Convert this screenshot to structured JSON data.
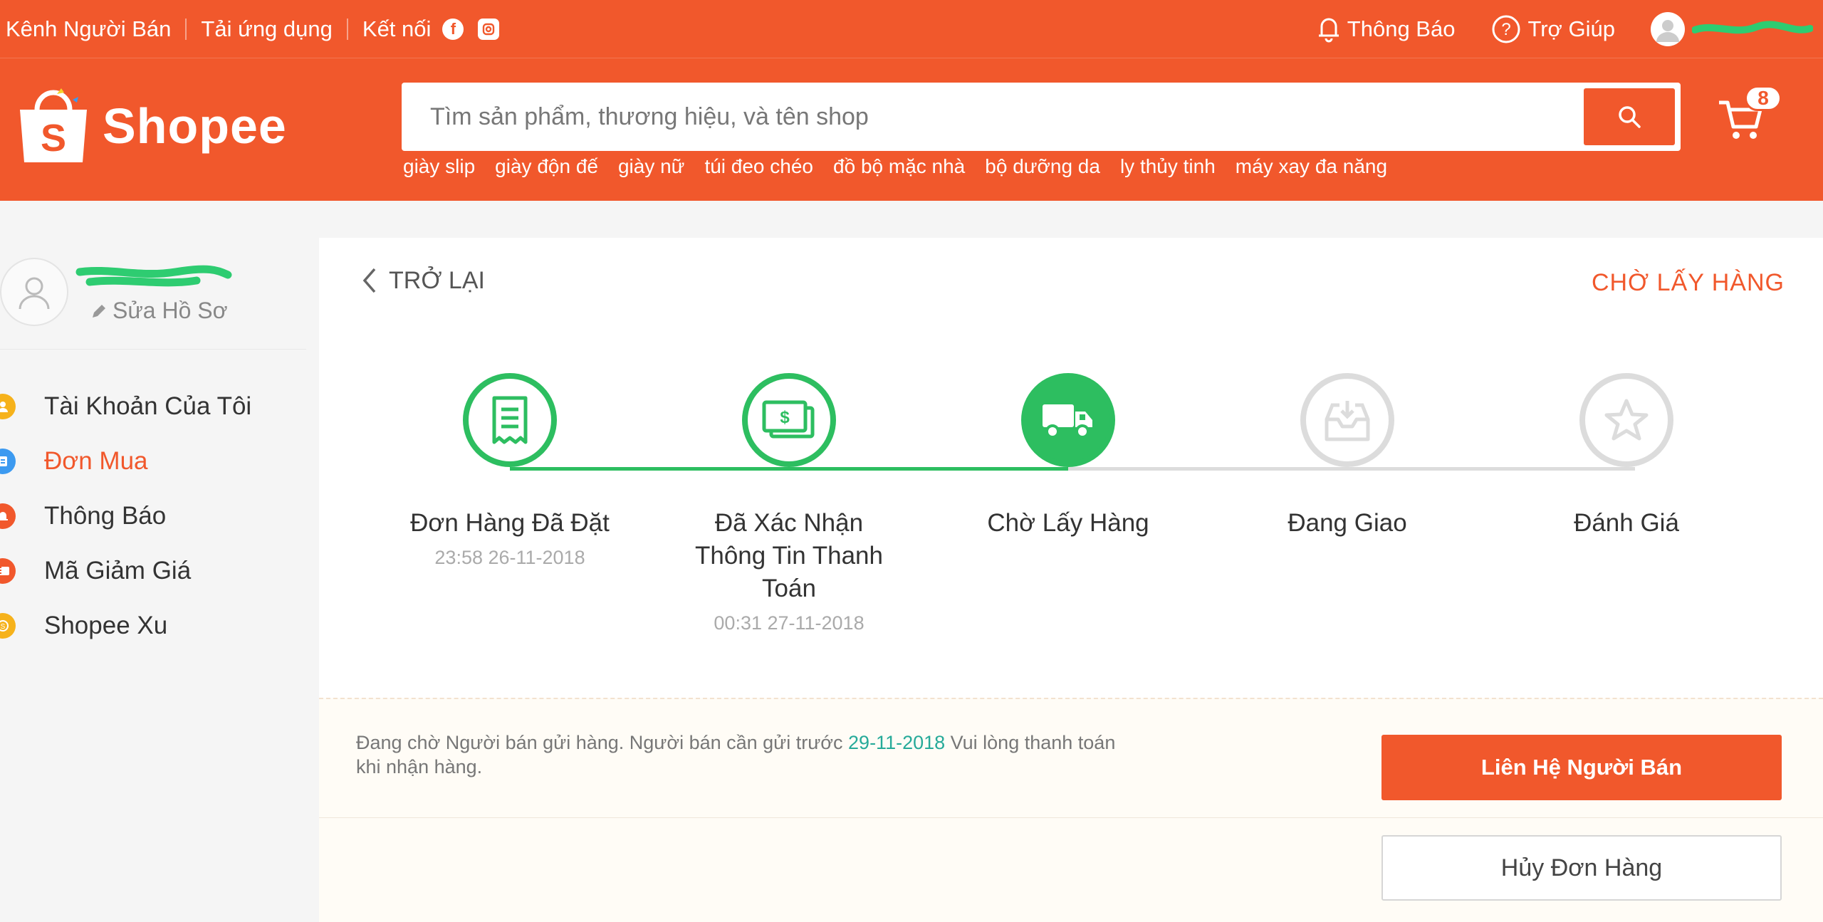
{
  "topbar": {
    "seller_channel": "Kênh Người Bán",
    "download_app": "Tải ứng dụng",
    "connect": "Kết nối",
    "notifications": "Thông Báo",
    "help": "Trợ Giúp"
  },
  "header": {
    "logo_text": "Shopee",
    "search_placeholder": "Tìm sản phẩm, thương hiệu, và tên shop",
    "suggestions": [
      "giày slip",
      "giày độn đế",
      "giày nữ",
      "túi đeo chéo",
      "đồ bộ mặc nhà",
      "bộ dưỡng da",
      "ly thủy tinh",
      "máy xay đa năng"
    ],
    "cart_count": "8",
    "brand_color": "#f1582c"
  },
  "sidebar": {
    "edit_profile": "Sửa Hồ Sơ",
    "items": [
      {
        "label": "Tài Khoản Của Tôi",
        "icon": "user-icon",
        "color": "#f6b21b"
      },
      {
        "label": "Đơn Mua",
        "icon": "order-icon",
        "color": "#3c9af0"
      },
      {
        "label": "Thông Báo",
        "icon": "bell-icon",
        "color": "#f1582c"
      },
      {
        "label": "Mã Giảm Giá",
        "icon": "voucher-icon",
        "color": "#f1582c"
      },
      {
        "label": "Shopee Xu",
        "icon": "coin-icon",
        "color": "#f6b21b"
      }
    ],
    "active_index": 1
  },
  "order": {
    "back_label": "TRỞ LẠI",
    "status_label": "CHỜ LẤY HÀNG",
    "steps": [
      {
        "title": "Đơn Hàng Đã Đặt",
        "time": "23:58 26-11-2018",
        "icon": "receipt-icon",
        "state": "done"
      },
      {
        "title": "Đã Xác Nhận Thông Tin Thanh Toán",
        "time": "00:31 27-11-2018",
        "icon": "money-icon",
        "state": "done"
      },
      {
        "title": "Chờ Lấy Hàng",
        "time": "",
        "icon": "truck-icon",
        "state": "current"
      },
      {
        "title": "Đang Giao",
        "time": "",
        "icon": "inbox-icon",
        "state": "todo"
      },
      {
        "title": "Đánh Giá",
        "time": "",
        "icon": "star-icon",
        "state": "todo"
      }
    ],
    "notice_before": "Đang chờ Người bán gửi hàng. Người bán cần gửi trước ",
    "notice_date": "29-11-2018",
    "notice_after": " Vui lòng thanh toán khi nhận hàng.",
    "contact_button": "Liên Hệ Người Bán",
    "cancel_button": "Hủy Đơn Hàng",
    "green": "#2dbe60",
    "grey": "#dcdcdc"
  }
}
